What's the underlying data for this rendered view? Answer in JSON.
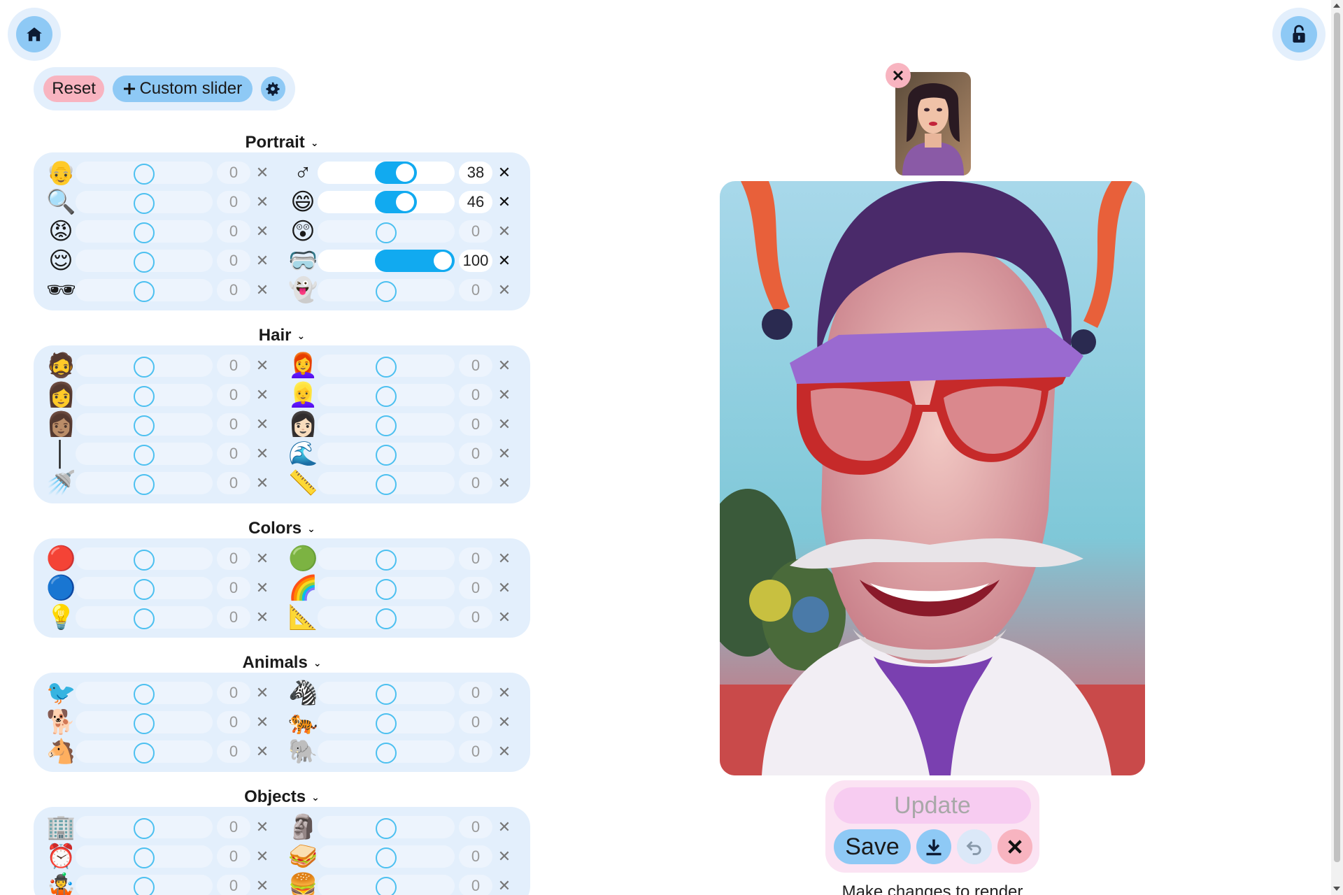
{
  "toolbar": {
    "reset_label": "Reset",
    "custom_slider_label": "Custom slider"
  },
  "sections": [
    {
      "title": "Portrait",
      "rows": [
        [
          {
            "emoji": "👴",
            "value": "0"
          },
          {
            "emoji": "♂",
            "value": "38",
            "level": 0.38
          }
        ],
        [
          {
            "emoji": "🔍",
            "value": "0"
          },
          {
            "emoji": "😄",
            "value": "46",
            "level": 0.46
          }
        ],
        [
          {
            "emoji": "😡",
            "value": "0"
          },
          {
            "emoji": "😲",
            "value": "0"
          }
        ],
        [
          {
            "emoji": "😌",
            "value": "0"
          },
          {
            "emoji": "🥽",
            "value": "100",
            "level": 1.0
          }
        ],
        [
          {
            "emoji": "🕶",
            "value": "0"
          },
          {
            "emoji": "👻",
            "value": "0"
          }
        ]
      ]
    },
    {
      "title": "Hair",
      "rows": [
        [
          {
            "emoji": "🧔",
            "value": "0"
          },
          {
            "emoji": "👩‍🦰",
            "value": "0"
          }
        ],
        [
          {
            "emoji": "👩",
            "value": "0"
          },
          {
            "emoji": "👱‍♀️",
            "value": "0"
          }
        ],
        [
          {
            "emoji": "👩🏽",
            "value": "0"
          },
          {
            "emoji": "👩🏻",
            "value": "0"
          }
        ],
        [
          {
            "emoji": "│",
            "value": "0"
          },
          {
            "emoji": "🌊",
            "value": "0"
          }
        ],
        [
          {
            "emoji": "🚿",
            "value": "0"
          },
          {
            "emoji": "📏",
            "value": "0"
          }
        ]
      ]
    },
    {
      "title": "Colors",
      "rows": [
        [
          {
            "emoji": "🔴",
            "value": "0"
          },
          {
            "emoji": "🟢",
            "value": "0"
          }
        ],
        [
          {
            "emoji": "🔵",
            "value": "0"
          },
          {
            "emoji": "🌈",
            "value": "0"
          }
        ],
        [
          {
            "emoji": "💡",
            "value": "0"
          },
          {
            "emoji": "📐",
            "value": "0"
          }
        ]
      ]
    },
    {
      "title": "Animals",
      "rows": [
        [
          {
            "emoji": "🐦",
            "value": "0"
          },
          {
            "emoji": "🦓",
            "value": "0"
          }
        ],
        [
          {
            "emoji": "🐕",
            "value": "0"
          },
          {
            "emoji": "🐅",
            "value": "0"
          }
        ],
        [
          {
            "emoji": "🐴",
            "value": "0"
          },
          {
            "emoji": "🐘",
            "value": "0"
          }
        ]
      ]
    },
    {
      "title": "Objects",
      "rows": [
        [
          {
            "emoji": "🏢",
            "value": "0"
          },
          {
            "emoji": "🗿",
            "value": "0"
          }
        ],
        [
          {
            "emoji": "⏰",
            "value": "0"
          },
          {
            "emoji": "🥪",
            "value": "0"
          }
        ],
        [
          {
            "emoji": "🤹",
            "value": "0"
          },
          {
            "emoji": "🍔",
            "value": "0"
          }
        ]
      ]
    }
  ],
  "actions": {
    "update_label": "Update",
    "save_label": "Save"
  },
  "status": {
    "text": "Make changes to render"
  },
  "colors": {
    "accent": "#11aaf0",
    "panel": "#e3effc",
    "reset": "#f8b4c0",
    "button": "#8ec9f5",
    "action_panel": "#fbe3f3"
  },
  "icons": {
    "home": "home-icon",
    "lock": "unlock-icon",
    "settings": "gear-icon",
    "download": "download-icon",
    "undo": "undo-icon",
    "close": "close-icon"
  }
}
